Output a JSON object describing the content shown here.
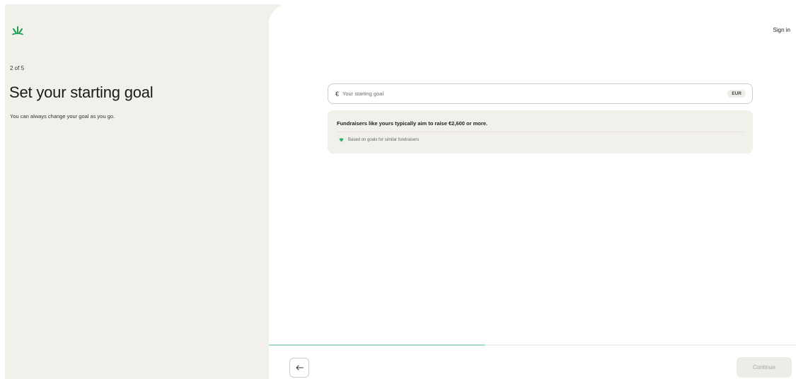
{
  "left": {
    "step": "2 of 5",
    "title": "Set your starting goal",
    "subtitle": "You can always change your goal as you go."
  },
  "header": {
    "sign_in_label": "Sign in"
  },
  "goal_input": {
    "currency_symbol": "€",
    "placeholder": "Your starting goal",
    "value": "",
    "currency_badge": "EUR"
  },
  "suggestion": {
    "text": "Fundraisers like yours typically aim to raise €2,600 or more.",
    "source": "Based on goals for similar fundraisers",
    "icon": "leaf-icon"
  },
  "progress": {
    "fraction": 0.41
  },
  "footer": {
    "back_icon": "arrow-left-icon",
    "continue_label": "Continue",
    "continue_enabled": false
  },
  "colors": {
    "brand_green": "#1f9d55",
    "left_panel_bg": "#f2f0ea",
    "progress_fill": "#a6dcc4"
  }
}
